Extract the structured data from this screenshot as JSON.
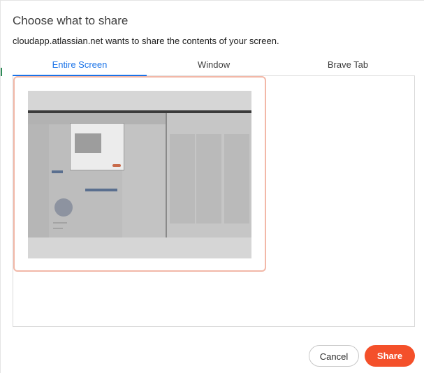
{
  "dialog": {
    "title": "Choose what to share",
    "subtitle": "cloudapp.atlassian.net wants to share the contents of your screen."
  },
  "tabs": [
    {
      "label": "Entire Screen",
      "selected": true
    },
    {
      "label": "Window",
      "selected": false
    },
    {
      "label": "Brave Tab",
      "selected": false
    }
  ],
  "sources": [
    {
      "kind": "entire-screen",
      "selected": true
    }
  ],
  "buttons": {
    "cancel_label": "Cancel",
    "share_label": "Share"
  },
  "colors": {
    "accent": "#1a73e8",
    "share_button": "#f4502a",
    "selected_border": "#f2b8a8"
  }
}
